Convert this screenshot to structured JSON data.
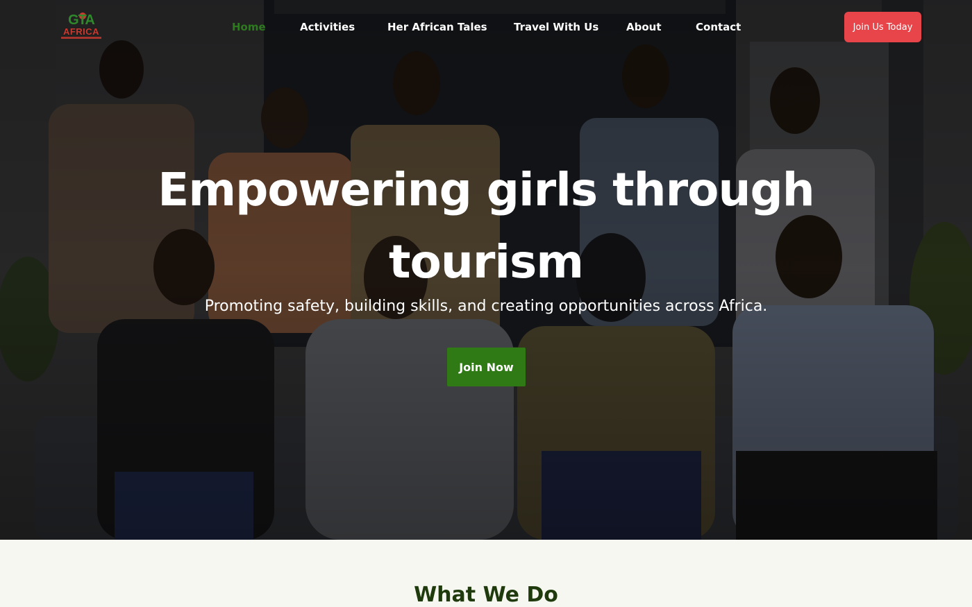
{
  "header": {
    "logo_top": "GTA",
    "logo_word": "AFRICA",
    "nav": [
      {
        "label": "Home",
        "active": true
      },
      {
        "label": "Activities",
        "active": false
      },
      {
        "label": "Her African Tales",
        "active": false
      },
      {
        "label": "Travel With Us",
        "active": false
      },
      {
        "label": "About",
        "active": false
      },
      {
        "label": "Contact",
        "active": false
      }
    ],
    "cta_label": "Join Us Today"
  },
  "hero": {
    "title": "Empowering girls through tourism",
    "subtitle": "Promoting safety, building skills, and creating opportunities across Africa.",
    "button_label": "Join Now",
    "image_alt": "group-photo-icon"
  },
  "section": {
    "title": "What We Do"
  },
  "colors": {
    "accent_green": "#2f7a15",
    "cta_red": "#e8454a",
    "active_nav": "#2d7a1f",
    "section_bg": "#f6f7f0",
    "section_title": "#1f3a0c"
  }
}
